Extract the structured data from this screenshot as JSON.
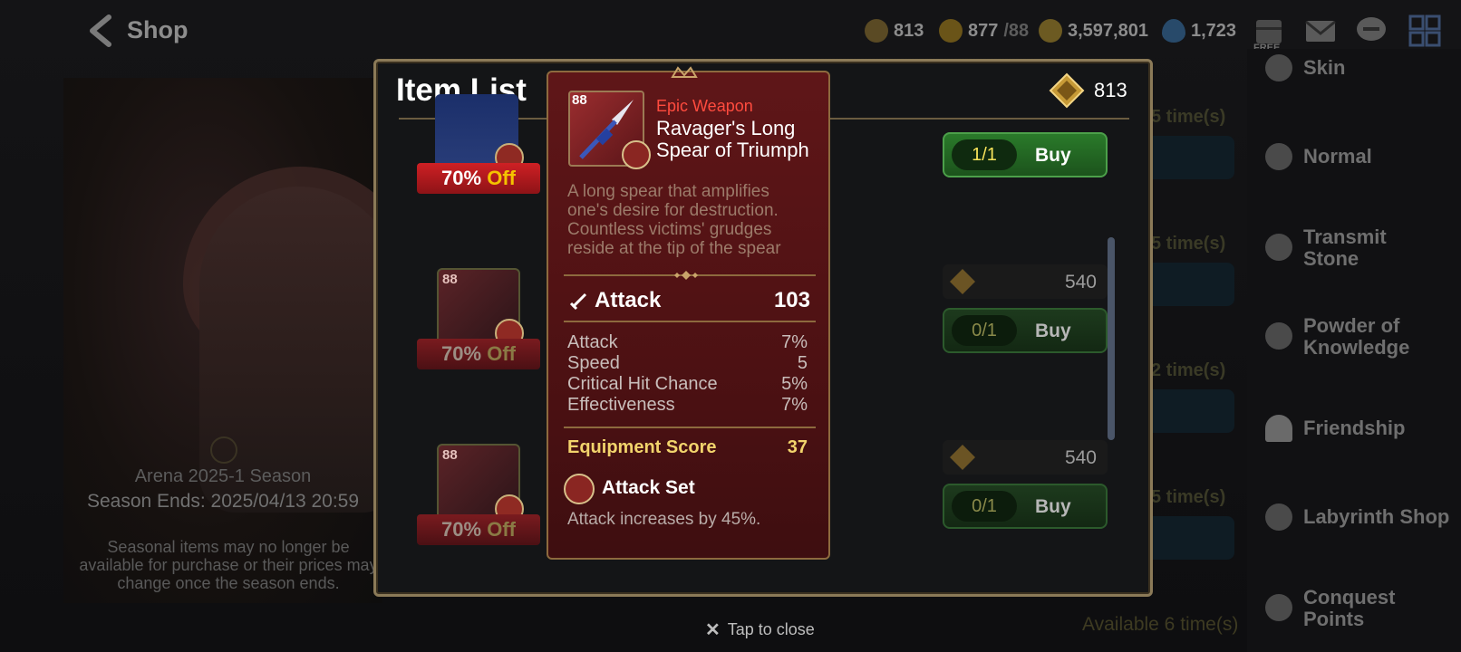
{
  "topbar": {
    "back_label": "Shop",
    "currencies": [
      {
        "icon": "arena-flag-icon",
        "value": "813"
      },
      {
        "icon": "stamina-icon",
        "value": "877",
        "max": "/88"
      },
      {
        "icon": "gold-icon",
        "value": "3,597,801"
      },
      {
        "icon": "skystone-icon",
        "value": "1,723"
      }
    ],
    "free_tag": "FREE"
  },
  "season": {
    "title": "Arena 2025-1 Season",
    "ends": "Season Ends: 2025/04/13 20:59",
    "note": "Seasonal items may no longer be available for purchase or their prices may change once the season ends."
  },
  "background_list": {
    "ghost_times": [
      "5 time(s)",
      "5 time(s)",
      "2 time(s)",
      "5 time(s)"
    ],
    "ghost_buy_fragment": "y",
    "available_text": "Available 6 time(s)"
  },
  "sidebar": {
    "items": [
      {
        "label": "Skin",
        "icon": "skin-icon"
      },
      {
        "label": "Normal",
        "icon": "globe-icon"
      },
      {
        "label": "Transmit Stone",
        "icon": "transmit-stone-icon"
      },
      {
        "label": "Powder of Knowledge",
        "icon": "powder-icon"
      },
      {
        "label": "Friendship",
        "icon": "heart-icon"
      },
      {
        "label": "Labyrinth Shop",
        "icon": "labyrinth-icon"
      },
      {
        "label": "Conquest Points",
        "icon": "conquest-icon"
      }
    ]
  },
  "modal": {
    "title": "Item List",
    "currency_value": "813",
    "items": [
      {
        "level": "88",
        "discount_pct": "70%",
        "discount_off": "Off",
        "price": "",
        "count": "1/1",
        "buy_label": "Buy"
      },
      {
        "level": "88",
        "discount_pct": "70%",
        "discount_off": "Off",
        "price": "540",
        "count": "0/1",
        "buy_label": "Buy"
      },
      {
        "level": "88",
        "discount_pct": "70%",
        "discount_off": "Off",
        "price": "540",
        "count": "0/1",
        "buy_label": "Buy"
      }
    ]
  },
  "tooltip": {
    "level": "88",
    "rarity": "Epic Weapon",
    "name": "Ravager's Long Spear of Triumph",
    "description": "A long spear that amplifies one's desire for destruction. Countless victims' grudges reside at the tip of the spear",
    "main_stat": {
      "label": "Attack",
      "value": "103"
    },
    "sub_stats": [
      {
        "label": "Attack",
        "value": "7%"
      },
      {
        "label": "Speed",
        "value": "5"
      },
      {
        "label": "Critical Hit Chance",
        "value": "5%"
      },
      {
        "label": "Effectiveness",
        "value": "7%"
      }
    ],
    "score": {
      "label": "Equipment Score",
      "value": "37"
    },
    "set": {
      "name": "Attack Set",
      "description": "Attack increases by 45%."
    }
  },
  "close_hint": {
    "icon": "close-x-icon",
    "label": "Tap to close"
  }
}
